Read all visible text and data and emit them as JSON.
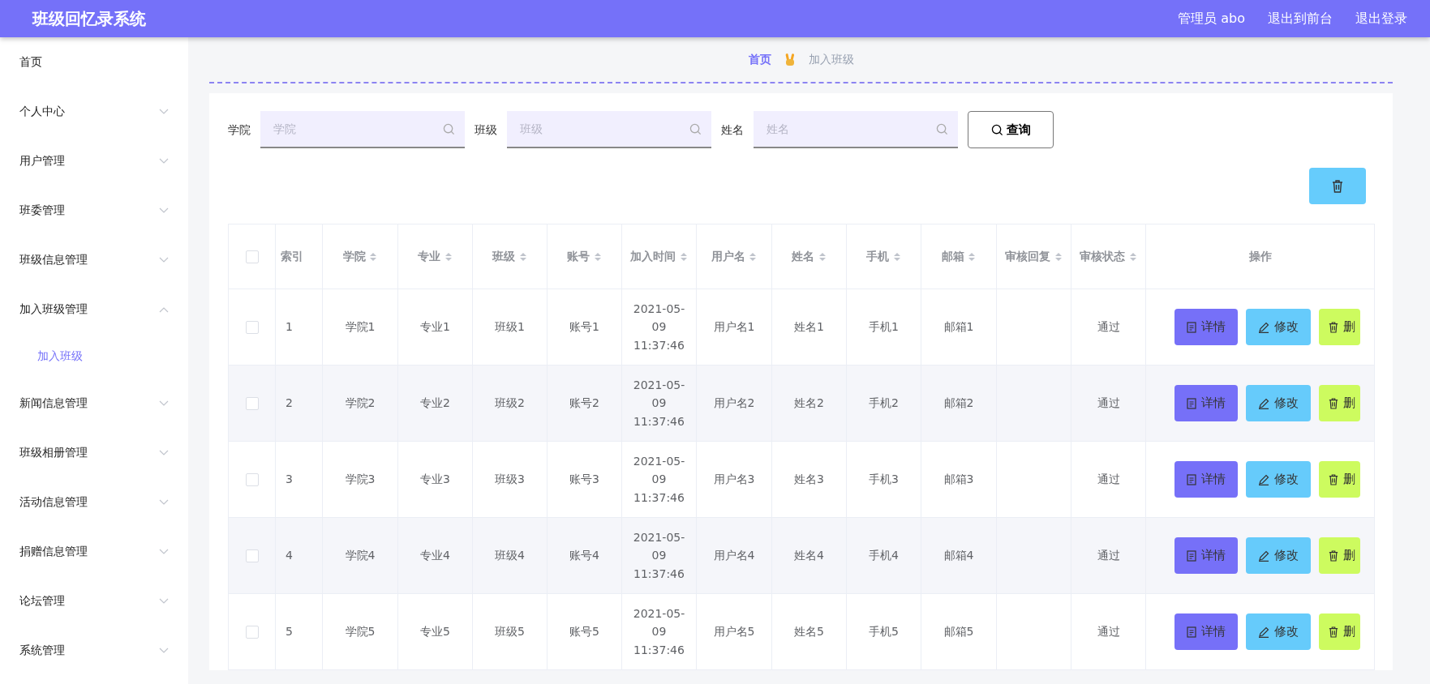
{
  "header": {
    "title": "班级回忆录系统",
    "links": [
      "管理员 abo",
      "退出到前台",
      "退出登录"
    ]
  },
  "sidebar": {
    "items": [
      {
        "label": "首页",
        "expandable": false
      },
      {
        "label": "个人中心",
        "expandable": true,
        "expanded": false
      },
      {
        "label": "用户管理",
        "expandable": true,
        "expanded": false
      },
      {
        "label": "班委管理",
        "expandable": true,
        "expanded": false
      },
      {
        "label": "班级信息管理",
        "expandable": true,
        "expanded": false
      },
      {
        "label": "加入班级管理",
        "expandable": true,
        "expanded": true,
        "children": [
          {
            "label": "加入班级",
            "selected": true
          }
        ]
      },
      {
        "label": "新闻信息管理",
        "expandable": true,
        "expanded": false
      },
      {
        "label": "班级相册管理",
        "expandable": true,
        "expanded": false
      },
      {
        "label": "活动信息管理",
        "expandable": true,
        "expanded": false
      },
      {
        "label": "捐赠信息管理",
        "expandable": true,
        "expanded": false
      },
      {
        "label": "论坛管理",
        "expandable": true,
        "expanded": false
      },
      {
        "label": "系统管理",
        "expandable": true,
        "expanded": false
      }
    ]
  },
  "breadcrumb": [
    {
      "label": "首页",
      "current": false
    },
    {
      "label": "加入班级",
      "current": true
    }
  ],
  "search": {
    "fields": [
      {
        "label": "学院",
        "placeholder": "学院"
      },
      {
        "label": "班级",
        "placeholder": "班级"
      },
      {
        "label": "姓名",
        "placeholder": "姓名"
      }
    ],
    "button": "查询"
  },
  "table": {
    "select_all_checked": false,
    "columns": [
      {
        "label": "索引",
        "sortable": false
      },
      {
        "label": "学院",
        "sortable": true
      },
      {
        "label": "专业",
        "sortable": true
      },
      {
        "label": "班级",
        "sortable": true
      },
      {
        "label": "账号",
        "sortable": true
      },
      {
        "label": "加入时间",
        "sortable": true
      },
      {
        "label": "用户名",
        "sortable": true
      },
      {
        "label": "姓名",
        "sortable": true
      },
      {
        "label": "手机",
        "sortable": true
      },
      {
        "label": "邮箱",
        "sortable": true
      },
      {
        "label": "审核回复",
        "sortable": true
      },
      {
        "label": "审核状态",
        "sortable": true
      },
      {
        "label": "操作",
        "sortable": false
      }
    ],
    "rows": [
      {
        "checked": false,
        "cells": [
          "1",
          "学院1",
          "专业1",
          "班级1",
          "账号1",
          "2021-05-09 11:37:46",
          "用户名1",
          "姓名1",
          "手机1",
          "邮箱1",
          null,
          "通过"
        ],
        "actions": [
          {
            "kind": "detail",
            "label": "详情"
          },
          {
            "kind": "edit",
            "label": "修改"
          },
          {
            "kind": "delete",
            "label": "删"
          }
        ]
      },
      {
        "checked": false,
        "cells": [
          "2",
          "学院2",
          "专业2",
          "班级2",
          "账号2",
          "2021-05-09 11:37:46",
          "用户名2",
          "姓名2",
          "手机2",
          "邮箱2",
          null,
          "通过"
        ],
        "actions": [
          {
            "kind": "detail",
            "label": "详情"
          },
          {
            "kind": "edit",
            "label": "修改"
          },
          {
            "kind": "delete",
            "label": "删"
          }
        ]
      },
      {
        "checked": false,
        "cells": [
          "3",
          "学院3",
          "专业3",
          "班级3",
          "账号3",
          "2021-05-09 11:37:46",
          "用户名3",
          "姓名3",
          "手机3",
          "邮箱3",
          null,
          "通过"
        ],
        "actions": [
          {
            "kind": "detail",
            "label": "详情"
          },
          {
            "kind": "edit",
            "label": "修改"
          },
          {
            "kind": "delete",
            "label": "删"
          }
        ]
      },
      {
        "checked": false,
        "cells": [
          "4",
          "学院4",
          "专业4",
          "班级4",
          "账号4",
          "2021-05-09 11:37:46",
          "用户名4",
          "姓名4",
          "手机4",
          "邮箱4",
          null,
          "通过"
        ],
        "actions": [
          {
            "kind": "detail",
            "label": "详情"
          },
          {
            "kind": "edit",
            "label": "修改"
          },
          {
            "kind": "delete",
            "label": "删"
          }
        ]
      },
      {
        "checked": false,
        "cells": [
          "5",
          "学院5",
          "专业5",
          "班级5",
          "账号5",
          "2021-05-09 11:37:46",
          "用户名5",
          "姓名5",
          "手机5",
          "邮箱5",
          null,
          "通过"
        ],
        "actions": [
          {
            "kind": "detail",
            "label": "详情"
          },
          {
            "kind": "edit",
            "label": "修改"
          },
          {
            "kind": "delete",
            "label": "删"
          }
        ]
      }
    ]
  }
}
